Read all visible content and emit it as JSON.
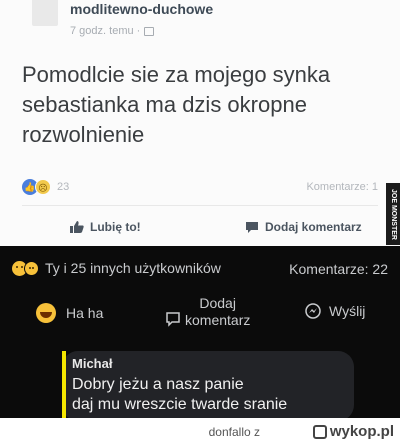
{
  "top_post": {
    "page_name": "modlitewno-duchowe",
    "time": "7 godz. temu ·",
    "text": "Pomodlcie sie za mojego synka sebastianka ma dzis okropne rozwolnienie",
    "reaction_count": "23",
    "comments": "Komentarze: 1",
    "like_label": "Lubię to!",
    "comment_label": "Dodaj komentarz",
    "watermark": "JOE MONSTER"
  },
  "dark_post": {
    "reaction_summary": "Ty i 25 innych użytkowników",
    "comments": "Komentarze: 22",
    "haha_label": "Ha ha",
    "comment_label_1": "Dodaj",
    "comment_label_2": "komentarz",
    "send_label": "Wyślij"
  },
  "reply": {
    "author": "Michał",
    "line1": "Dobry jeżu a nasz panie",
    "line2": "daj mu wreszcie twarde sranie"
  },
  "footer": {
    "credit": "donfallo z",
    "site": "wykop.pl"
  },
  "colors": {
    "light_bg": "#fbfbfb",
    "dark_bg": "#0b0b0b",
    "reply_accent": "#f5e600",
    "like_blue": "#4a7edc"
  }
}
